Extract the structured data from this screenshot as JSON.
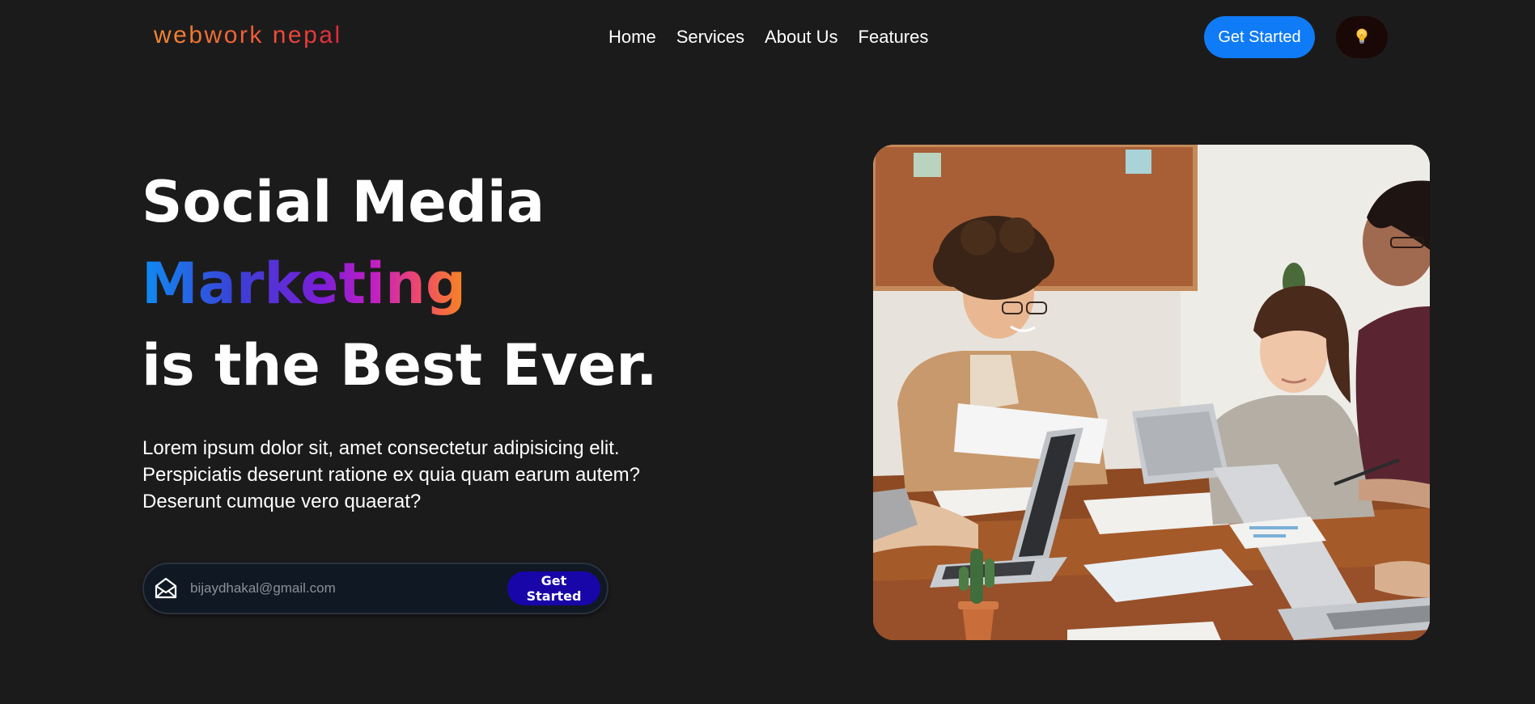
{
  "brand": {
    "logo_text": "webwork nepal"
  },
  "nav": {
    "items": [
      {
        "label": "Home"
      },
      {
        "label": "Services"
      },
      {
        "label": "About Us"
      },
      {
        "label": "Features"
      }
    ],
    "cta_label": "Get Started",
    "theme_toggle_icon": "lightbulb-icon"
  },
  "hero": {
    "title_line1": "Social Media",
    "title_highlight": "Marketing",
    "title_line3": "is the Best Ever.",
    "description": "Lorem ipsum dolor sit, amet consectetur adipisicing elit. Perspiciatis deserunt ratione ex quia quam earum autem? Deserunt cumque vero quaerat?",
    "email_placeholder": "bijaydhakal@gmail.com",
    "email_icon": "envelope-icon",
    "form_cta_label": "Get Started"
  },
  "colors": {
    "background": "#1c1b1c",
    "nav_cta": "#0f7bf6",
    "form_cta": "#1806a8",
    "theme_toggle_bg": "#1a0806"
  }
}
